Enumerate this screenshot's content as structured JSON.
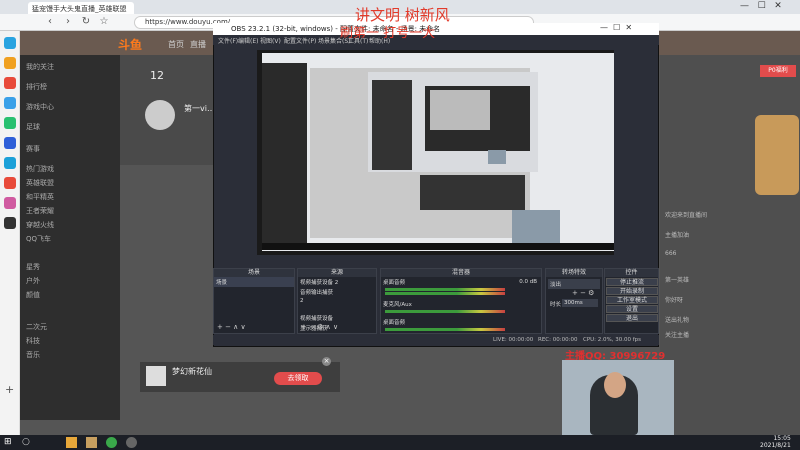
{
  "browser": {
    "tab_title": "猛宠馒手大头鬼直播_英雄联盟",
    "url": "https://www.douyu.com/…",
    "window_controls": [
      "—",
      "☐",
      "✕"
    ]
  },
  "douyu": {
    "logo": "斗鱼",
    "top_links": [
      "首页",
      "直播",
      "分类"
    ],
    "anchor_name": "第一vi…",
    "anchor_count": "12",
    "sidebar": [
      "我的关注",
      "排行榜",
      "游戏中心",
      "足球",
      "赛事",
      "热门游戏",
      "英雄联盟",
      "和平精英",
      "王者荣耀",
      "穿越火线",
      "QQ飞车",
      "星秀",
      "户外",
      "颜值",
      "二次元",
      "科技",
      "音乐"
    ],
    "chat_lines": [
      "欢迎来到直播间",
      "主播加油",
      "666",
      "第一英雄",
      "你好呀",
      "送出礼物",
      "关注主播"
    ],
    "gift_name": "梦幻新花仙",
    "gift_btn": "去领取",
    "ad_text": "P0福利"
  },
  "obs": {
    "title": "OBS 23.2.1 (32-bit, windows) - 配置文件: 未命名 - 场景: 未命名",
    "menu": [
      "文件(F)",
      "编辑(E)",
      "视图(V)",
      "配置文件(P)",
      "场景集合(S)",
      "工具(T)",
      "帮助(H)"
    ],
    "docks": {
      "scenes": {
        "title": "场景",
        "items": [
          "场景"
        ]
      },
      "sources": {
        "title": "来源",
        "items": [
          "视频捕获设备 2",
          "音频输出捕获",
          "2",
          "视频捕获设备",
          "显示器捕获"
        ]
      },
      "mixer": {
        "title": "混音器",
        "channels": [
          {
            "name": "桌面音频",
            "db": "0.0 dB"
          },
          {
            "name": "麦克风/Aux",
            "db": "0.0 dB"
          },
          {
            "name": "桌面音频",
            "db": "0.0 dB"
          }
        ]
      },
      "transitions": {
        "title": "转场特效",
        "type": "淡出",
        "duration_label": "时长",
        "duration": "300ms"
      },
      "controls": {
        "title": "控件",
        "buttons": [
          "停止推流",
          "开始录制",
          "工作室模式",
          "设置",
          "退出"
        ]
      }
    },
    "status": {
      "live": "LIVE: 00:00:00",
      "rec": "REC: 00:00:00",
      "cpu": "CPU: 2.0%, 30.00 fps"
    }
  },
  "overlay": {
    "line1": "讲文明 树新风",
    "line2": "刷第一 打号一大",
    "streamer_id": "主播QQ: 30996729"
  },
  "taskbar": {
    "time": "15:05",
    "date": "2021/8/21"
  }
}
